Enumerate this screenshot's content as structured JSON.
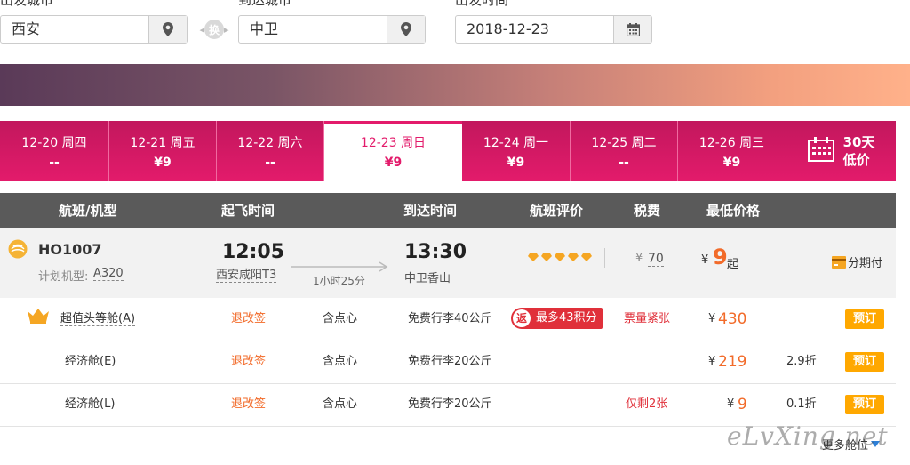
{
  "search": {
    "from_label": "出发城市",
    "from_value": "西安",
    "swap_label": "换",
    "to_label": "到达城市",
    "to_value": "中卫",
    "date_label": "出发时间",
    "date_value": "2018-12-23"
  },
  "dates": [
    {
      "date": "12-20",
      "weekday": "周四",
      "price": "--"
    },
    {
      "date": "12-21",
      "weekday": "周五",
      "price": "¥9"
    },
    {
      "date": "12-22",
      "weekday": "周六",
      "price": "--"
    },
    {
      "date": "12-23",
      "weekday": "周日",
      "price": "¥9"
    },
    {
      "date": "12-24",
      "weekday": "周一",
      "price": "¥9"
    },
    {
      "date": "12-25",
      "weekday": "周二",
      "price": "--"
    },
    {
      "date": "12-26",
      "weekday": "周三",
      "price": "¥9"
    }
  ],
  "calendar": {
    "line1": "30天",
    "line2": "低价"
  },
  "table_header": {
    "flight": "航班/机型",
    "depart": "起飞时间",
    "arrive": "到达时间",
    "rating": "航班评价",
    "tax": "税费",
    "lowest": "最低价格"
  },
  "flight": {
    "number": "HO1007",
    "model_label": "计划机型:",
    "model": "A320",
    "depart_time": "12:05",
    "depart_airport": "西安咸阳T3",
    "duration": "1小时25分",
    "arrive_time": "13:30",
    "arrive_airport": "中卫香山",
    "tax_symbol": "¥",
    "tax": "70",
    "price_symbol": "¥",
    "price": "9",
    "price_suffix": "起",
    "installment": "分期付"
  },
  "cabins": [
    {
      "name": "超值头等舱(A)",
      "refund": "退改签",
      "meal": "含点心",
      "baggage": "免费行李40公斤",
      "promo_badge": "返",
      "promo_text": "最多43积分",
      "status": "票量紧张",
      "price_symbol": "¥",
      "price": "430",
      "discount": "",
      "book": "预订"
    },
    {
      "name": "经济舱(E)",
      "refund": "退改签",
      "meal": "含点心",
      "baggage": "免费行李20公斤",
      "status": "",
      "price_symbol": "¥",
      "price": "219",
      "discount": "2.9折",
      "book": "预订"
    },
    {
      "name": "经济舱(L)",
      "refund": "退改签",
      "meal": "含点心",
      "baggage": "免费行李20公斤",
      "status": "仅剩2张",
      "price_symbol": "¥",
      "price": "9",
      "discount": "0.1折",
      "book": "预订"
    }
  ],
  "more_cabins": "更多舱位",
  "watermark": "eLvXing.net",
  "colors": {
    "accent": "#e31b6b",
    "book": "#ffa800",
    "price": "#f26b2a"
  }
}
